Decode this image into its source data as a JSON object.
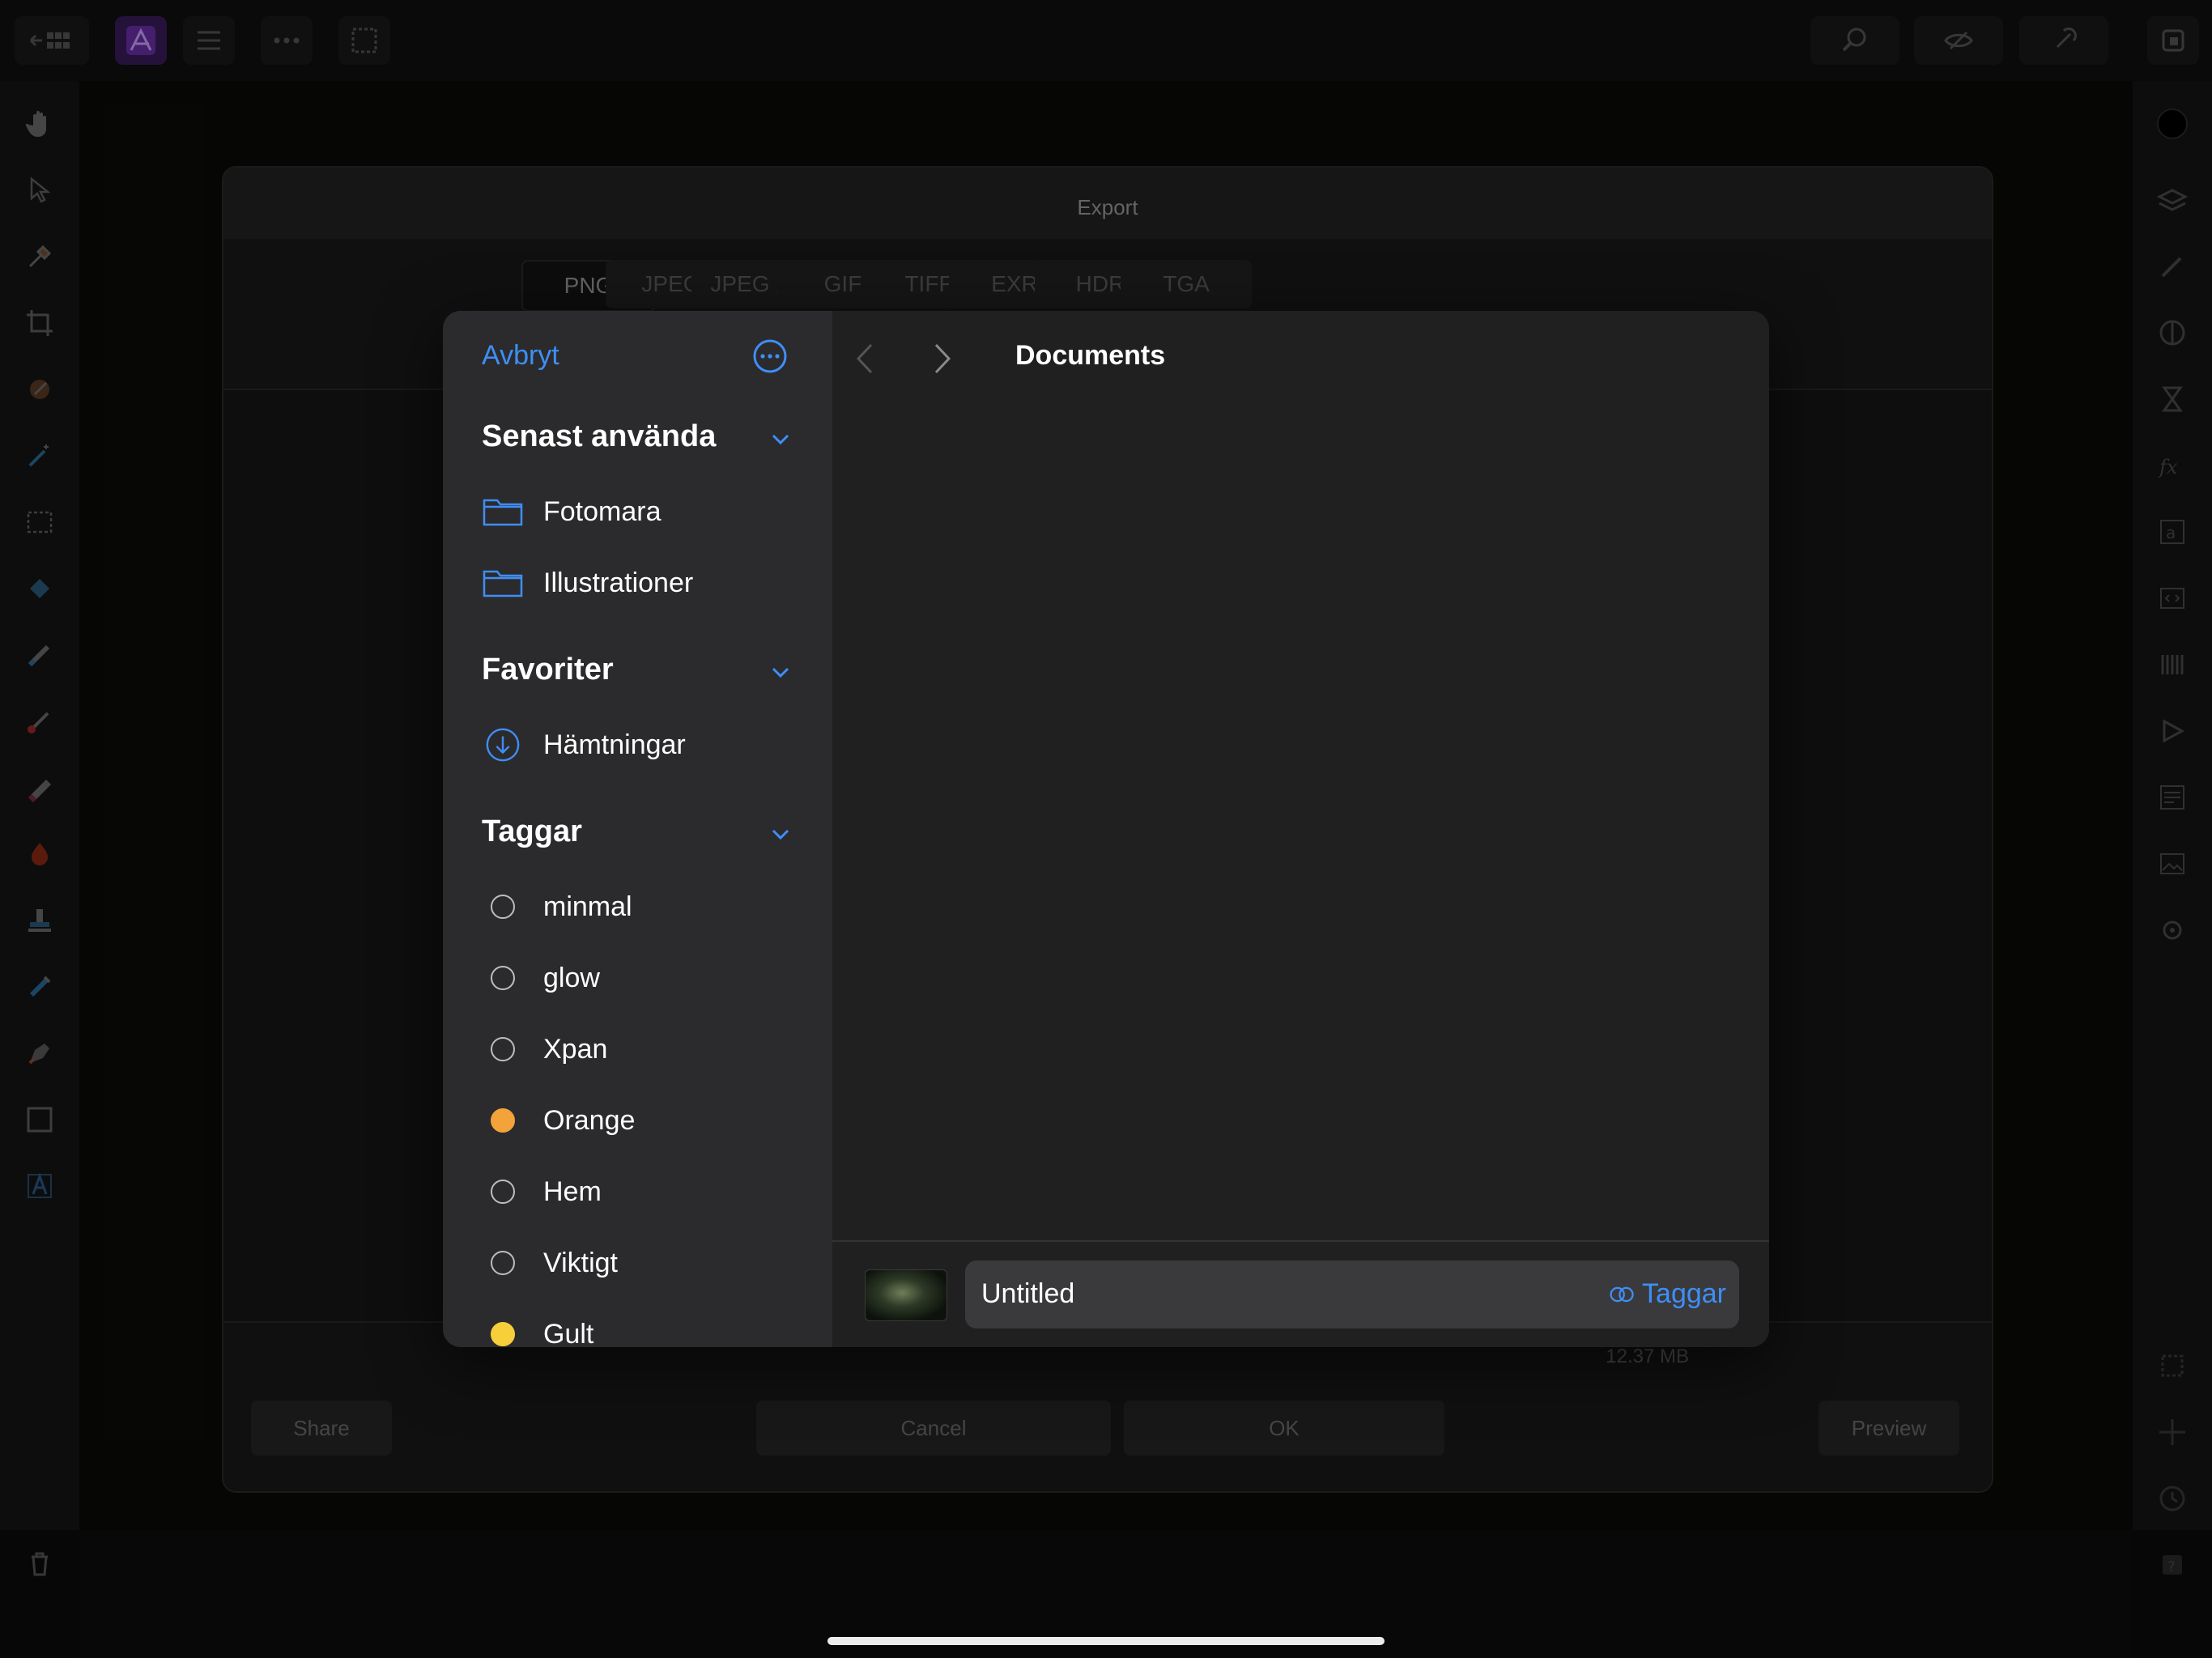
{
  "export_dialog": {
    "title": "Export",
    "formats": [
      "PNG",
      "JPEG",
      "JPEG XL",
      "GIF",
      "TIFF",
      "EXR",
      "HDR",
      "TGA"
    ],
    "selected_format": "PNG",
    "file_size": "12.37 MB",
    "buttons": {
      "share": "Share",
      "cancel": "Cancel",
      "ok": "OK",
      "preview": "Preview"
    }
  },
  "picker": {
    "cancel_label": "Avbryt",
    "location": "Documents",
    "sections": {
      "recents": {
        "title": "Senast använda",
        "items": [
          "Fotomara",
          "Illustrationer"
        ]
      },
      "favorites": {
        "title": "Favoriter",
        "items": [
          "Hämtningar"
        ]
      },
      "tags": {
        "title": "Taggar",
        "items": [
          {
            "label": "minmal",
            "color": ""
          },
          {
            "label": "glow",
            "color": ""
          },
          {
            "label": "Xpan",
            "color": ""
          },
          {
            "label": "Orange",
            "color": "#f3a33a"
          },
          {
            "label": "Hem",
            "color": ""
          },
          {
            "label": "Viktigt",
            "color": ""
          },
          {
            "label": "Gult",
            "color": "#f6cf3a"
          }
        ]
      }
    },
    "filename": "Untitled",
    "tags_button": "Taggar"
  },
  "colors": {
    "accent": "#3f8ef7"
  },
  "icons": [
    "back-icon",
    "grid-icon",
    "app-logo-icon",
    "menu-icon",
    "more-icon",
    "selection-icon",
    "zoom-icon",
    "view-icon",
    "snapping-icon",
    "hand-icon",
    "move-icon",
    "brush-icon",
    "crop-icon",
    "folder-icon",
    "download-icon",
    "chevron-down-icon",
    "ellipsis-circle-icon",
    "chevron-left-icon",
    "chevron-right-icon",
    "tag-icon",
    "trash-icon"
  ]
}
